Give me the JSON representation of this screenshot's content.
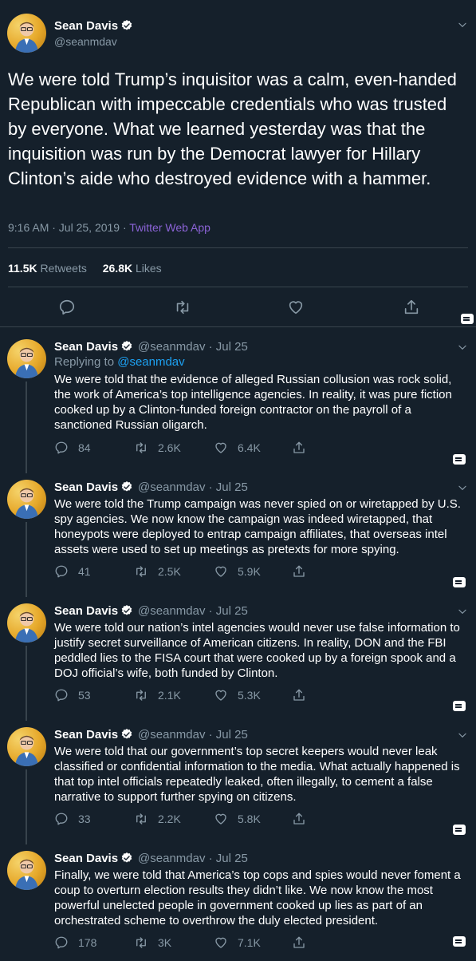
{
  "main": {
    "author": "Sean Davis",
    "handle": "@seanmdav",
    "text": "We were told Trump’s inquisitor was a calm, even-handed Republican with impeccable credentials who was trusted by everyone. What we learned yesterday was that the inquisition was run by the Democrat lawyer for Hillary Clinton’s aide who destroyed evidence with a hammer.",
    "timestamp": "9:16 AM · Jul 25, 2019 · ",
    "source": "Twitter Web App",
    "retweets_count": "11.5K",
    "retweets_label": "Retweets",
    "likes_count": "26.8K",
    "likes_label": "Likes"
  },
  "replies": [
    {
      "author": "Sean Davis",
      "handle": "@seanmdav · Jul 25",
      "replying_prefix": "Replying to ",
      "replying_to": "@seanmdav",
      "text": "We were told that the evidence of alleged Russian collusion was rock solid, the work of America’s top intelligence agencies. In reality, it was pure fiction cooked up by a Clinton-funded foreign contractor on the payroll of a sanctioned Russian oligarch.",
      "replies": "84",
      "retweets": "2.6K",
      "likes": "6.4K"
    },
    {
      "author": "Sean Davis",
      "handle": "@seanmdav · Jul 25",
      "text": "We were told the Trump campaign was never spied on or wiretapped by U.S. spy agencies. We now know the campaign was indeed wiretapped, that honeypots were deployed to entrap campaign affiliates, that overseas intel assets were used to set up meetings as pretexts for more spying.",
      "replies": "41",
      "retweets": "2.5K",
      "likes": "5.9K"
    },
    {
      "author": "Sean Davis",
      "handle": "@seanmdav · Jul 25",
      "text": "We were told our nation’s intel agencies would never use false information to justify secret surveillance of American citizens. In reality, DON and the FBI peddled lies to the FISA court that were cooked up by a foreign spook and a DOJ official’s wife, both funded by Clinton.",
      "replies": "53",
      "retweets": "2.1K",
      "likes": "5.3K"
    },
    {
      "author": "Sean Davis",
      "handle": "@seanmdav · Jul 25",
      "text": "We were told that our government’s top secret keepers would never leak classified or confidential information to the media. What actually happened is that top intel officials repeatedly leaked, often illegally, to cement a false narrative to support further spying on citizens.",
      "replies": "33",
      "retweets": "2.2K",
      "likes": "5.8K"
    },
    {
      "author": "Sean Davis",
      "handle": "@seanmdav · Jul 25",
      "text": "Finally, we were told that America’s top cops and spies would never foment a coup to overturn election results they didn’t like. We now know the most powerful unelected people in government cooked up lies as part of an orchestrated scheme to overthrow the duly elected president.",
      "replies": "178",
      "retweets": "3K",
      "likes": "7.1K"
    }
  ],
  "colors": {
    "background": "#15202b",
    "text": "#ffffff",
    "muted": "#8899a6",
    "link": "#1da1f2",
    "source": "#8b63d6",
    "divider": "#38444d"
  }
}
